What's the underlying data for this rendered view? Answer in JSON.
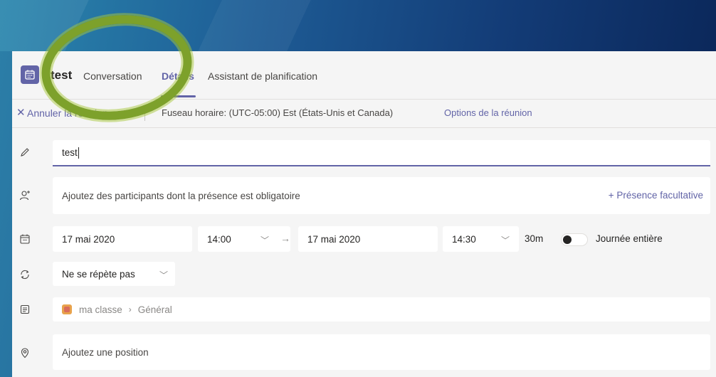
{
  "header": {
    "title": "test",
    "tabs": [
      {
        "label": "Conversation"
      },
      {
        "label": "Détails"
      },
      {
        "label": "Assistant de planification"
      }
    ]
  },
  "toolbar": {
    "cancel_label": "Annuler la réunion",
    "timezone": "Fuseau horaire: (UTC-05:00) Est (États-Unis et Canada)",
    "options_label": "Options de la réunion"
  },
  "form": {
    "title_value": "test",
    "participants_placeholder": "Ajoutez des participants dont la présence est obligatoire",
    "optional_presence": "+ Présence facultative",
    "start_date": "17 mai 2020",
    "start_time": "14:00",
    "end_date": "17 mai 2020",
    "end_time": "14:30",
    "duration": "30m",
    "all_day_label": "Journée entière",
    "repeat": "Ne se répète pas",
    "channel_team": "ma classe",
    "channel_name": "Général",
    "location_placeholder": "Ajoutez une position"
  },
  "colors": {
    "accent": "#6264a7",
    "highlight": "#7da12b",
    "team_badge": "#e8a24c"
  },
  "icons": {
    "title_row": "pencil-icon",
    "participants_row": "add-person-icon",
    "date_row": "calendar-icon",
    "repeat_row": "repeat-icon",
    "channel_row": "channel-icon",
    "location_row": "location-pin-icon"
  }
}
